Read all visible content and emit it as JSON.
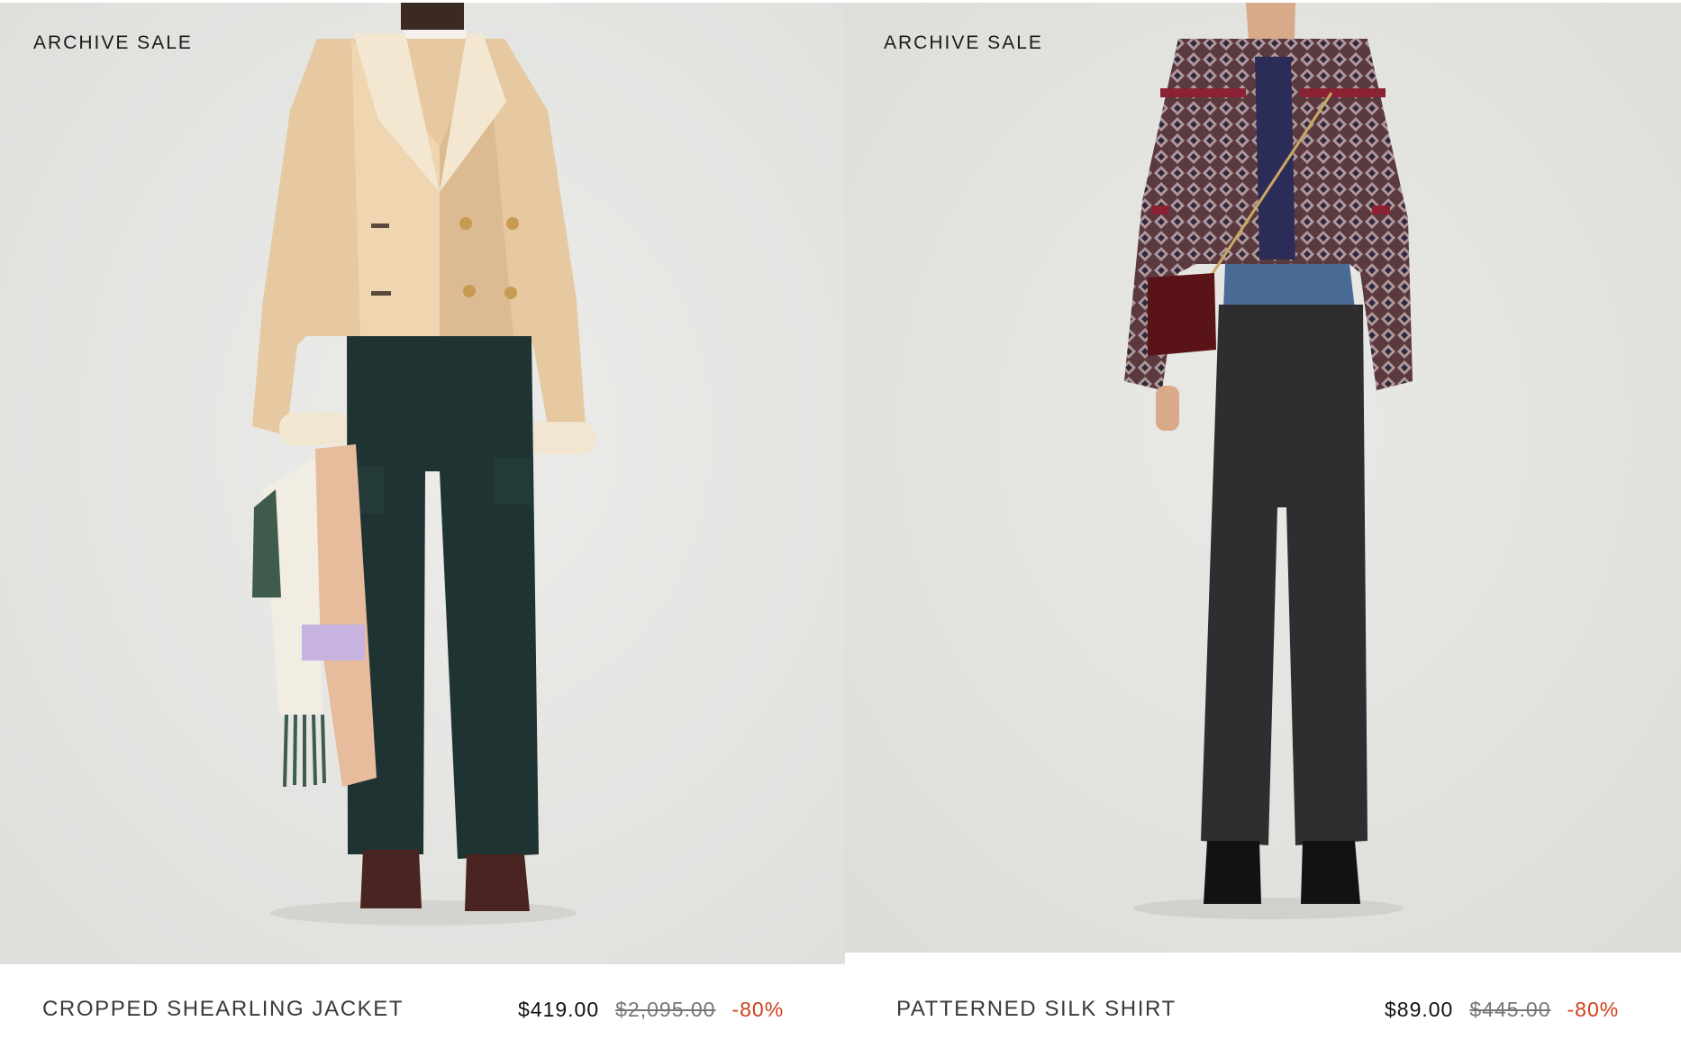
{
  "products": [
    {
      "badge": "ARCHIVE SALE",
      "name": "CROPPED SHEARLING JACKET",
      "price_now": "$419.00",
      "price_was": "$2,095.00",
      "discount": "-80%",
      "image_alt": "Model wearing beige cropped shearling jacket, dark green cargo jeans and holding a wool scarf"
    },
    {
      "badge": "ARCHIVE SALE",
      "name": "PATTERNED SILK SHIRT",
      "price_now": "$89.00",
      "price_was": "$445.00",
      "discount": "-80%",
      "image_alt": "Model wearing patterned silk shirt, layered jeans and a burgundy crossbody bag"
    }
  ],
  "colors": {
    "photo_bg": "#e6e6e3",
    "discount": "#d0401a",
    "text": "#3a3a3a"
  }
}
